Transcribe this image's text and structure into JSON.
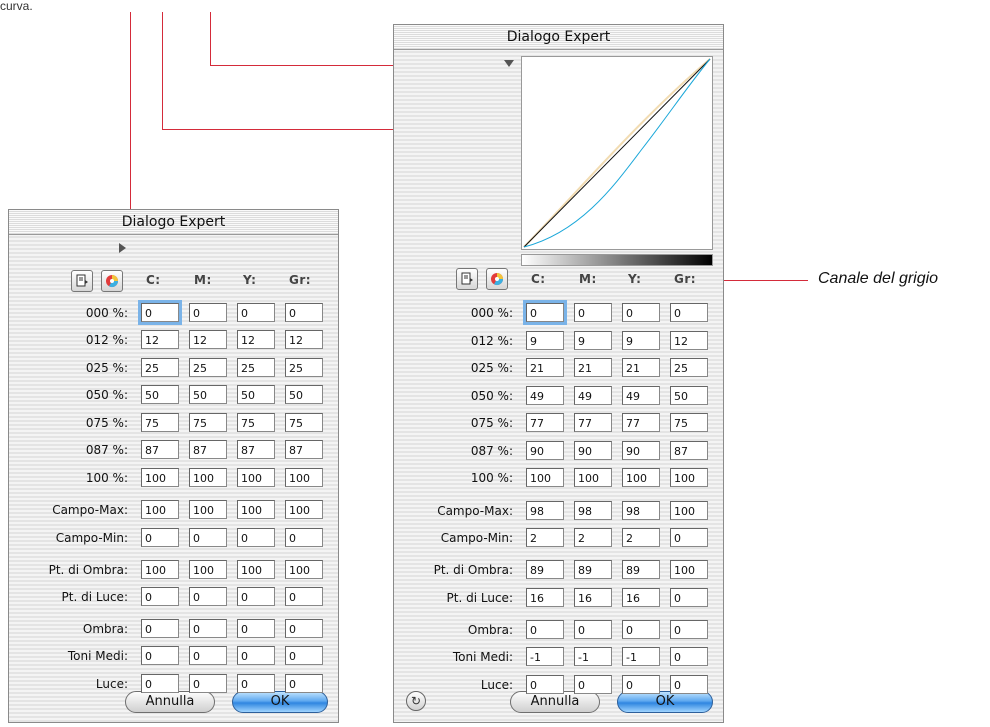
{
  "caption_top": "curva.",
  "callout_text": "Canale del grigio",
  "dialog_left": {
    "title": "Dialogo Expert",
    "channels": [
      "C:",
      "M:",
      "Y:",
      "Gr:"
    ],
    "rows": [
      {
        "label": "000 %:",
        "values": [
          "0",
          "0",
          "0",
          "0"
        ]
      },
      {
        "label": "012 %:",
        "values": [
          "12",
          "12",
          "12",
          "12"
        ]
      },
      {
        "label": "025 %:",
        "values": [
          "25",
          "25",
          "25",
          "25"
        ]
      },
      {
        "label": "050 %:",
        "values": [
          "50",
          "50",
          "50",
          "50"
        ]
      },
      {
        "label": "075 %:",
        "values": [
          "75",
          "75",
          "75",
          "75"
        ]
      },
      {
        "label": "087 %:",
        "values": [
          "87",
          "87",
          "87",
          "87"
        ]
      },
      {
        "label": "100 %:",
        "values": [
          "100",
          "100",
          "100",
          "100"
        ]
      },
      {
        "label": "Campo-Max:",
        "values": [
          "100",
          "100",
          "100",
          "100"
        ]
      },
      {
        "label": "Campo-Min:",
        "values": [
          "0",
          "0",
          "0",
          "0"
        ]
      },
      {
        "label": "Pt. di Ombra:",
        "values": [
          "100",
          "100",
          "100",
          "100"
        ]
      },
      {
        "label": "Pt. di Luce:",
        "values": [
          "0",
          "0",
          "0",
          "0"
        ]
      },
      {
        "label": "Ombra:",
        "values": [
          "0",
          "0",
          "0",
          "0"
        ]
      },
      {
        "label": "Toni Medi:",
        "values": [
          "0",
          "0",
          "0",
          "0"
        ]
      },
      {
        "label": "Luce:",
        "values": [
          "0",
          "0",
          "0",
          "0"
        ]
      }
    ],
    "cancel_label": "Annulla",
    "ok_label": "OK"
  },
  "dialog_right": {
    "title": "Dialogo Expert",
    "channels": [
      "C:",
      "M:",
      "Y:",
      "Gr:"
    ],
    "rows": [
      {
        "label": "000 %:",
        "values": [
          "0",
          "0",
          "0",
          "0"
        ]
      },
      {
        "label": "012 %:",
        "values": [
          "9",
          "9",
          "9",
          "12"
        ]
      },
      {
        "label": "025 %:",
        "values": [
          "21",
          "21",
          "21",
          "25"
        ]
      },
      {
        "label": "050 %:",
        "values": [
          "49",
          "49",
          "49",
          "50"
        ]
      },
      {
        "label": "075 %:",
        "values": [
          "77",
          "77",
          "77",
          "75"
        ]
      },
      {
        "label": "087 %:",
        "values": [
          "90",
          "90",
          "90",
          "87"
        ]
      },
      {
        "label": "100 %:",
        "values": [
          "100",
          "100",
          "100",
          "100"
        ]
      },
      {
        "label": "Campo-Max:",
        "values": [
          "98",
          "98",
          "98",
          "100"
        ]
      },
      {
        "label": "Campo-Min:",
        "values": [
          "2",
          "2",
          "2",
          "0"
        ]
      },
      {
        "label": "Pt. di Ombra:",
        "values": [
          "89",
          "89",
          "89",
          "100"
        ]
      },
      {
        "label": "Pt. di Luce:",
        "values": [
          "16",
          "16",
          "16",
          "0"
        ]
      },
      {
        "label": "Ombra:",
        "values": [
          "0",
          "0",
          "0",
          "0"
        ]
      },
      {
        "label": "Toni Medi:",
        "values": [
          "-1",
          "-1",
          "-1",
          "0"
        ]
      },
      {
        "label": "Luce:",
        "values": [
          "0",
          "0",
          "0",
          "0"
        ]
      }
    ],
    "cancel_label": "Annulla",
    "ok_label": "OK"
  },
  "colors": {
    "leader": "#d42b3a",
    "cyan_curve": "#1aa7d9",
    "yellow_curve": "#f2dcb2",
    "focus": "#7ab3e8",
    "ok_button": "#3a8fe4"
  }
}
